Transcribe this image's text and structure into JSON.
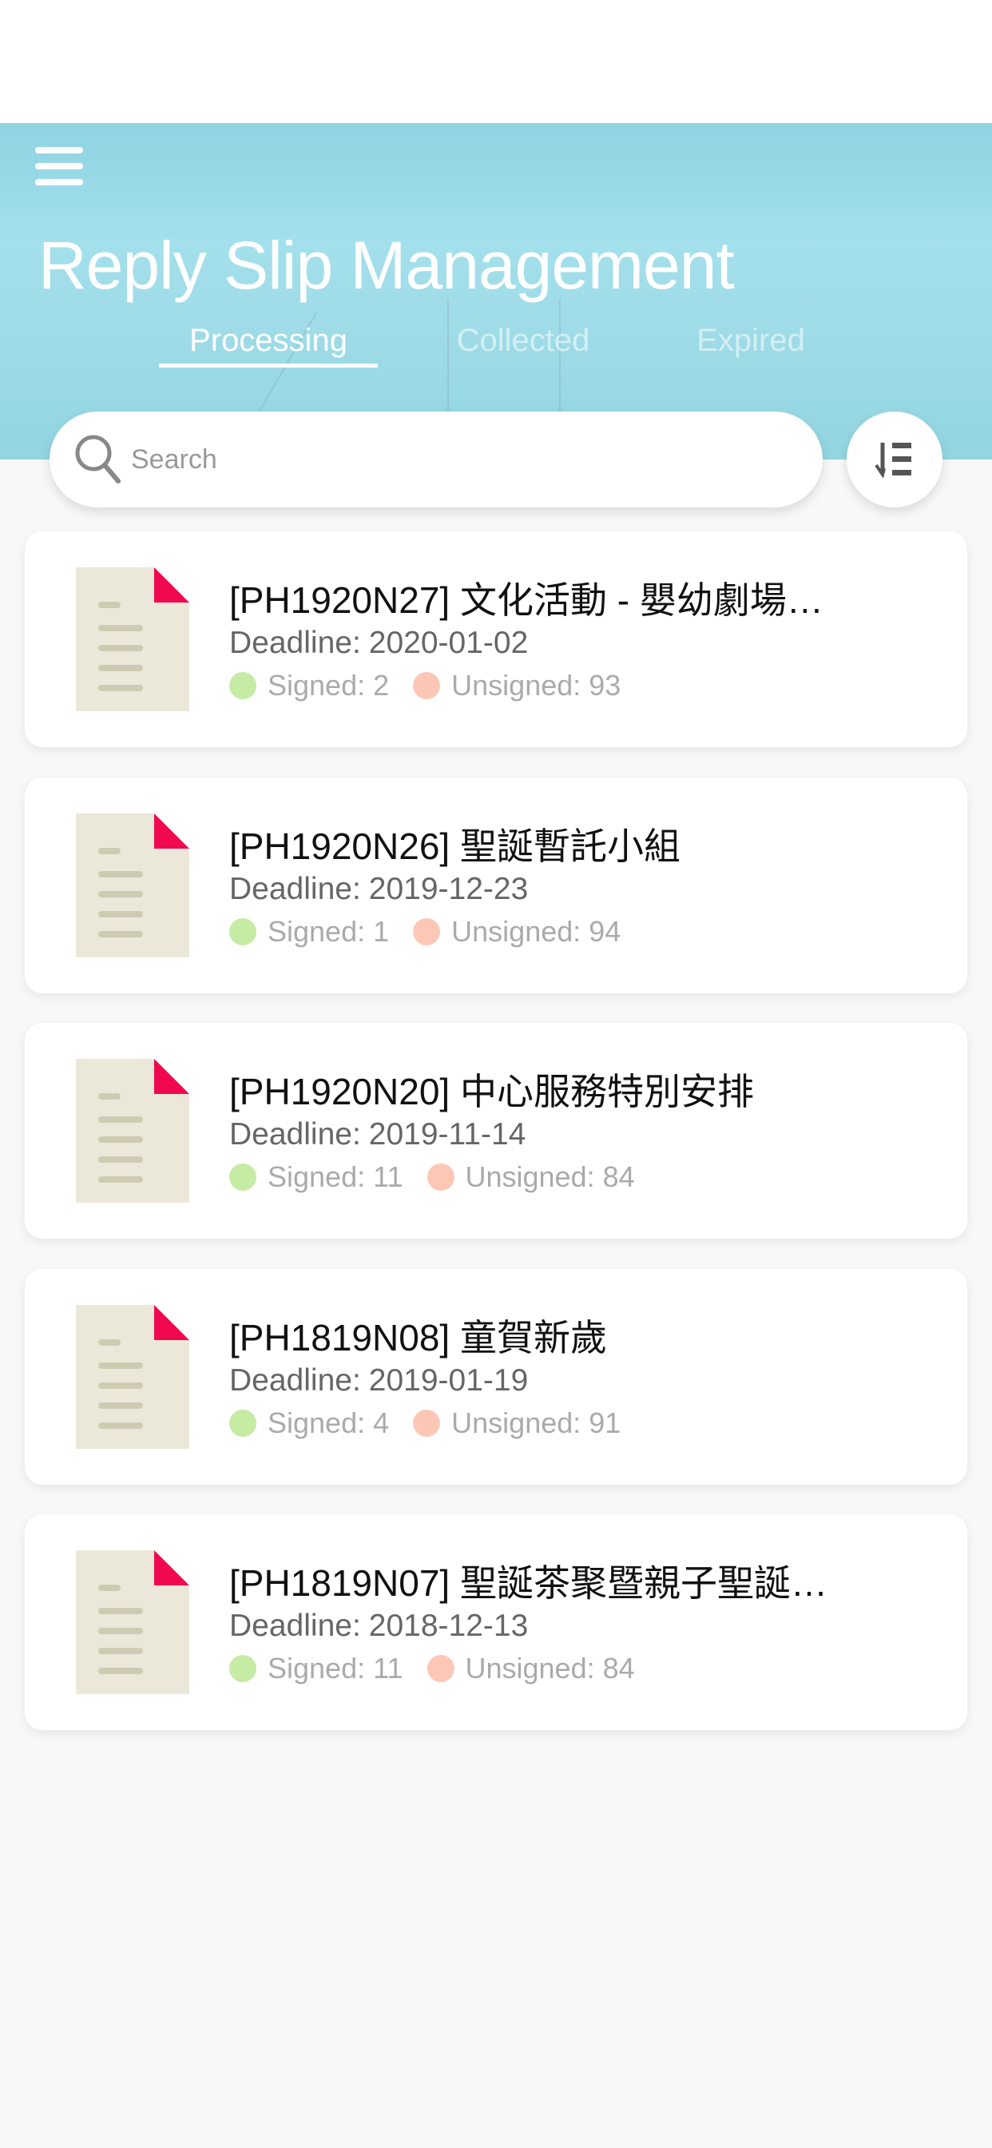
{
  "header": {
    "title": "Reply Slip Management",
    "menu_icon": "hamburger-menu-icon",
    "tabs": [
      {
        "label": "Processing",
        "active": true
      },
      {
        "label": "Collected",
        "active": false
      },
      {
        "label": "Expired",
        "active": false
      }
    ]
  },
  "search": {
    "placeholder": "Search",
    "value": "",
    "icon": "search-icon"
  },
  "sort_button": {
    "icon": "sort-list-icon"
  },
  "colors": {
    "accent": "#f0094f",
    "signed": "#c5eba4",
    "unsigned": "#fdc7b6",
    "header": "#9edbe7",
    "doc": "#ebe8d9"
  },
  "slips": [
    {
      "title": "[PH1920N27] 文化活動 - 嬰幼劇場…",
      "deadline_label": "Deadline:",
      "deadline": "2020-01-02",
      "signed_label": "Signed:",
      "signed": "2",
      "unsigned_label": "Unsigned:",
      "unsigned": "93"
    },
    {
      "title": "[PH1920N26] 聖誕暫託小組",
      "deadline_label": "Deadline:",
      "deadline": "2019-12-23",
      "signed_label": "Signed:",
      "signed": "1",
      "unsigned_label": "Unsigned:",
      "unsigned": "94"
    },
    {
      "title": "[PH1920N20] 中心服務特別安排",
      "deadline_label": "Deadline:",
      "deadline": "2019-11-14",
      "signed_label": "Signed:",
      "signed": "11",
      "unsigned_label": "Unsigned:",
      "unsigned": "84"
    },
    {
      "title": "[PH1819N08] 童賀新歲",
      "deadline_label": "Deadline:",
      "deadline": "2019-01-19",
      "signed_label": "Signed:",
      "signed": "4",
      "unsigned_label": "Unsigned:",
      "unsigned": "91"
    },
    {
      "title": "[PH1819N07] 聖誕茶聚暨親子聖誕…",
      "deadline_label": "Deadline:",
      "deadline": "2018-12-13",
      "signed_label": "Signed:",
      "signed": "11",
      "unsigned_label": "Unsigned:",
      "unsigned": "84"
    }
  ]
}
